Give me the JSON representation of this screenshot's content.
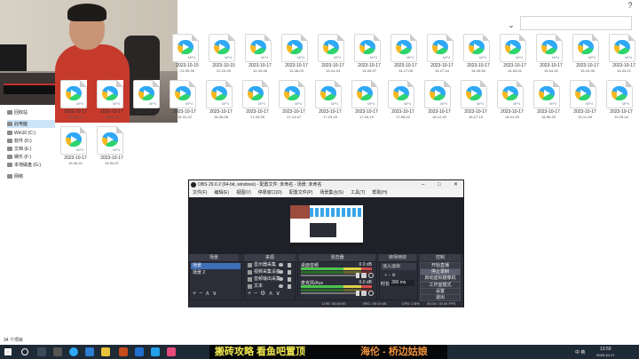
{
  "explorer": {
    "status": "34 个项目",
    "sidebar": [
      {
        "label": "回收站"
      },
      {
        "label": "此电脑",
        "selected": true
      },
      {
        "label": "Win10 (C:)"
      },
      {
        "label": "软件 (D:)"
      },
      {
        "label": "文档 (E:)"
      },
      {
        "label": "娱乐 (F:)"
      },
      {
        "label": "本地磁盘 (G:)"
      },
      {
        "label": "网络"
      }
    ],
    "file_badge": "MP4",
    "files": [
      {
        "date": "2023-10-15",
        "time": "21-59-30"
      },
      {
        "date": "2023-10-15",
        "time": "22-20-49"
      },
      {
        "date": "2023-10-17",
        "time": "12-43-46"
      },
      {
        "date": "2023-10-17",
        "time": "12-48-29"
      },
      {
        "date": "2023-10-17",
        "time": "13-41-44"
      },
      {
        "date": "2023-10-17",
        "time": "14-00-07"
      },
      {
        "date": "2023-10-17",
        "time": "14-17-05"
      },
      {
        "date": "2023-10-17",
        "time": "14-27-44"
      },
      {
        "date": "2023-10-17",
        "time": "14-39-50"
      },
      {
        "date": "2023-10-17",
        "time": "14-53-01"
      },
      {
        "date": "2023-10-17",
        "time": "15-04-52"
      },
      {
        "date": "2023-10-17",
        "time": "15-19-35"
      },
      {
        "date": "2023-10-17",
        "time": "15-33-21"
      },
      {
        "date": "2023-10-17",
        "time": "15-48-10"
      },
      {
        "date": "2023-10-17",
        "time": "16-02-34"
      },
      {
        "date": "2023-10-17",
        "time": "16-16-41"
      },
      {
        "date": "2023-10-17",
        "time": "16-31-22"
      },
      {
        "date": "2023-10-17",
        "time": "16-45-08"
      },
      {
        "date": "2023-10-17",
        "time": "17-00-05"
      },
      {
        "date": "2023-10-17",
        "time": "17-14-47"
      },
      {
        "date": "2023-10-17",
        "time": "17-29-33"
      },
      {
        "date": "2023-10-17",
        "time": "17-43-19"
      },
      {
        "date": "2023-10-17",
        "time": "17-58-02"
      },
      {
        "date": "2023-10-17",
        "time": "18-12-40"
      },
      {
        "date": "2023-10-17",
        "time": "18-27-15"
      },
      {
        "date": "2023-10-17",
        "time": "18-41-53"
      },
      {
        "date": "2023-10-17",
        "time": "18-56-30"
      },
      {
        "date": "2023-10-17",
        "time": "19-11-08"
      },
      {
        "date": "2023-10-17",
        "time": "19-25-44"
      },
      {
        "date": "2023-10-17",
        "time": "19-40-21"
      },
      {
        "date": "2023-10-17",
        "time": "19-54-57"
      },
      {
        "date": "2023-10-17",
        "time": "20-09-34"
      },
      {
        "date": "2023-10-17",
        "time": "20-24-10"
      },
      {
        "date": "2023-10-17",
        "time": "20-38-47"
      }
    ]
  },
  "obs": {
    "title": "OBS 29.0.2 (64-bit, windows) - 配置文件: 未命名 - 场景: 未命名",
    "menu": [
      "文件(F)",
      "编辑(E)",
      "视图(V)",
      "停靠窗口(D)",
      "配置文件(P)",
      "场景集合(S)",
      "工具(T)",
      "帮助(H)"
    ],
    "docks": {
      "scenes": "场景",
      "sources": "来源",
      "mixer": "混音器",
      "transitions": "转场特效",
      "controls": "控制"
    },
    "scenes": [
      {
        "label": "场景",
        "selected": true
      },
      {
        "label": "场景 2"
      }
    ],
    "sources": [
      "显示器采集",
      "视频采集设备",
      "音频输出采集",
      "文本"
    ],
    "mixer": [
      {
        "label": "桌面音频",
        "db": "0.0 dB"
      },
      {
        "label": "麦克风/Aux",
        "db": "0.0 dB"
      }
    ],
    "transitions": {
      "type": "淡入淡出",
      "duration_label": "时长",
      "duration": "300 ms"
    },
    "controls": [
      "开始直播",
      "停止录制",
      "启动虚拟摄像机",
      "工作室模式",
      "设置",
      "退出"
    ],
    "status": {
      "live": "LIVE: 00:00:00",
      "rec": "REC: 00:10:45",
      "cpu": "CPU: 2.8%",
      "fps": "30.00 / 30.00 FPS"
    }
  },
  "taskbar": {
    "ticker_a": "搬砖攻略 看鱼吧置顶",
    "ticker_b": "海伦 - 桥边姑娘",
    "ime": "中 英",
    "time": "13:59",
    "date": "2023-10-17"
  }
}
